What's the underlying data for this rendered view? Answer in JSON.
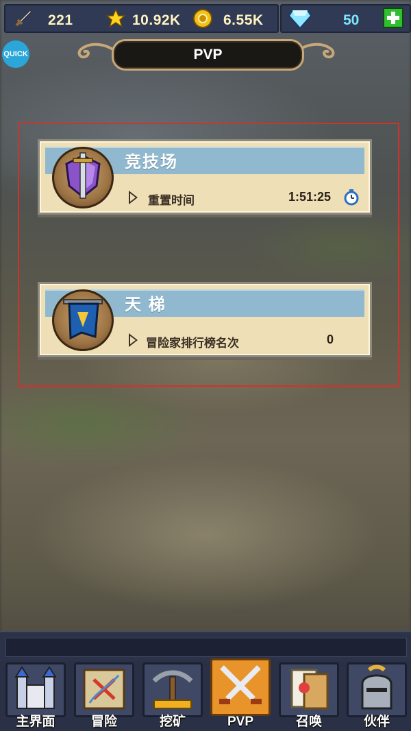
{
  "resources": {
    "attack": "221",
    "stars": "10.92K",
    "gold": "6.55K",
    "gems": "50"
  },
  "quick_label": "QUICK",
  "header": {
    "title": "PVP"
  },
  "modes": [
    {
      "title": "竞技场",
      "row_label": "重置时间",
      "row_value": "1:51:25",
      "icon": "sword-shield-medal-icon"
    },
    {
      "title": "天 梯",
      "row_label": "冒险家排行榜名次",
      "row_value": "0",
      "icon": "banner-scroll-medal-icon"
    }
  ],
  "nav": [
    {
      "label": "主界面",
      "icon": "castle-icon"
    },
    {
      "label": "冒险",
      "icon": "map-icon"
    },
    {
      "label": "挖矿",
      "icon": "pickaxe-icon"
    },
    {
      "label": "PVP",
      "icon": "crossed-swords-icon"
    },
    {
      "label": "召唤",
      "icon": "summon-card-icon"
    },
    {
      "label": "伙伴",
      "icon": "knight-helmet-icon"
    }
  ],
  "colors": {
    "accent": "#e8942a",
    "gem": "#7ee6ff",
    "frame": "#d6302a"
  }
}
